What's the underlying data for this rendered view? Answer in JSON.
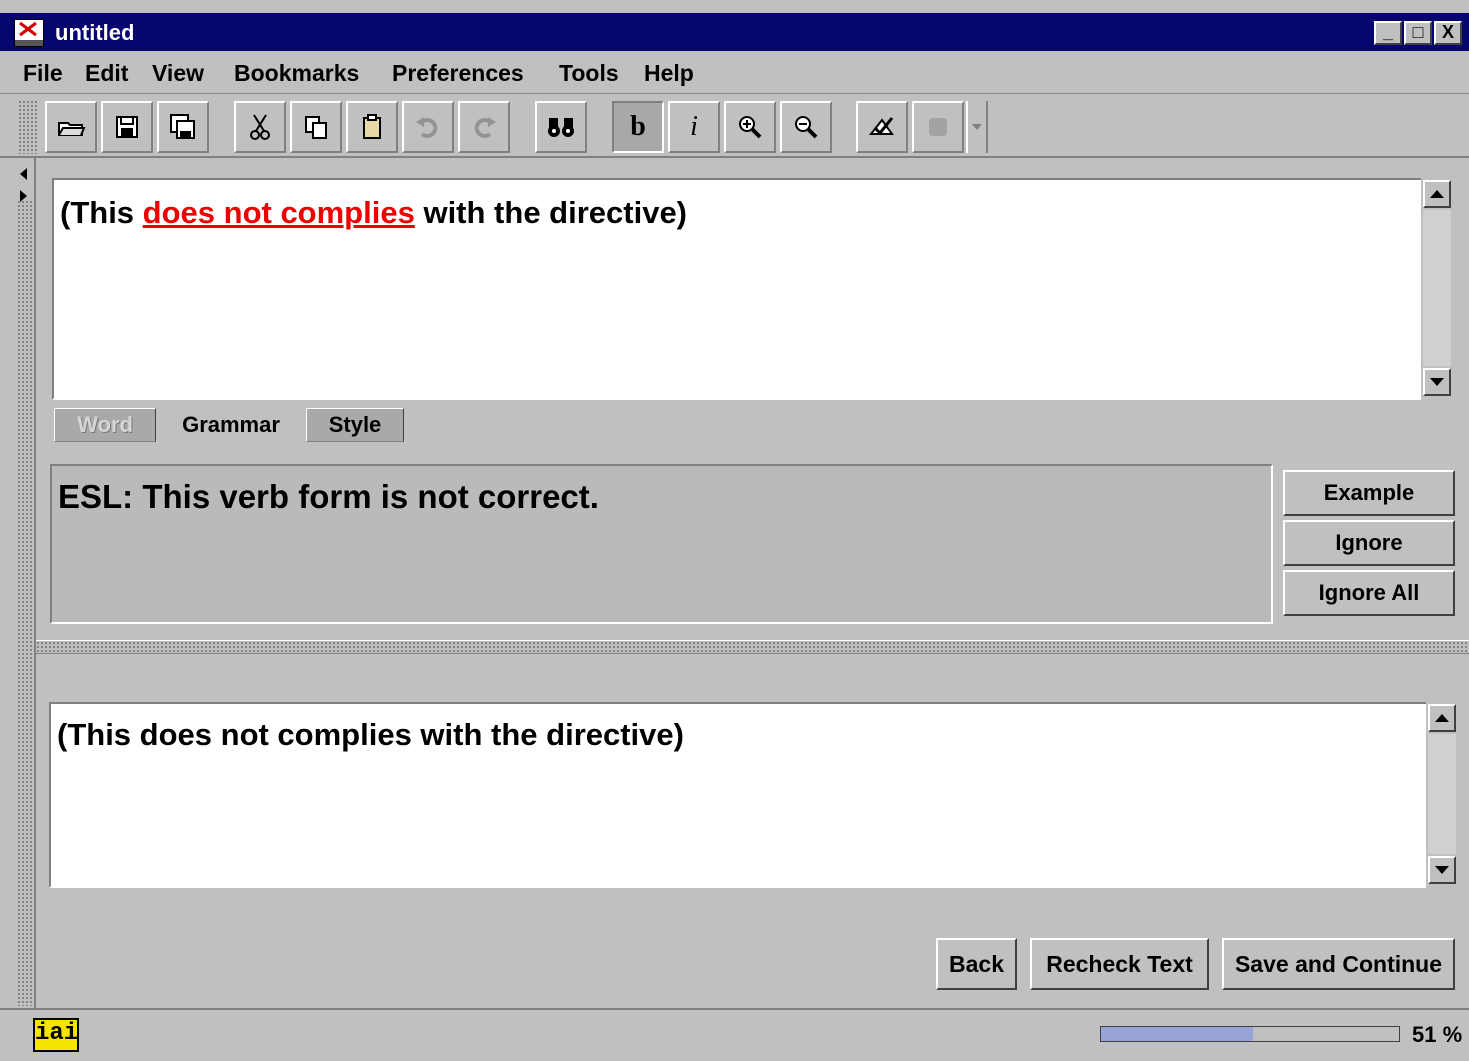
{
  "window": {
    "title": "untitled",
    "minimize": "_",
    "maximize": "□",
    "close": "X"
  },
  "menu": [
    "File",
    "Edit",
    "View",
    "Bookmarks",
    "Preferences",
    "Tools",
    "Help"
  ],
  "toolbar": {
    "icons": [
      "open-icon",
      "save-icon",
      "save-all-icon",
      "cut-icon",
      "copy-icon",
      "paste-icon",
      "undo-icon",
      "redo-icon",
      "find-icon",
      "bold-icon",
      "italic-icon",
      "zoom-in-icon",
      "zoom-out-icon",
      "check-icon",
      "stop-icon"
    ],
    "bold_label": "b",
    "italic_label": "i"
  },
  "editor": {
    "before": "(This ",
    "error": "does not complies",
    "after": " with the directive)"
  },
  "tabs": [
    "Word",
    "Grammar",
    "Style"
  ],
  "message": "ESL: This verb form is not correct.",
  "side_buttons": [
    "Example",
    "Ignore",
    "Ignore All"
  ],
  "suggestion": "(This does not complies with the directive)",
  "actions": [
    "Back",
    "Recheck Text",
    "Save and Continue"
  ],
  "status": {
    "logo": "iai",
    "progress": 0.51,
    "progress_label": "51 %"
  },
  "colors": {
    "titlebar": "#06066e",
    "error": "#ee0000",
    "progress": "#9aa3d6"
  }
}
